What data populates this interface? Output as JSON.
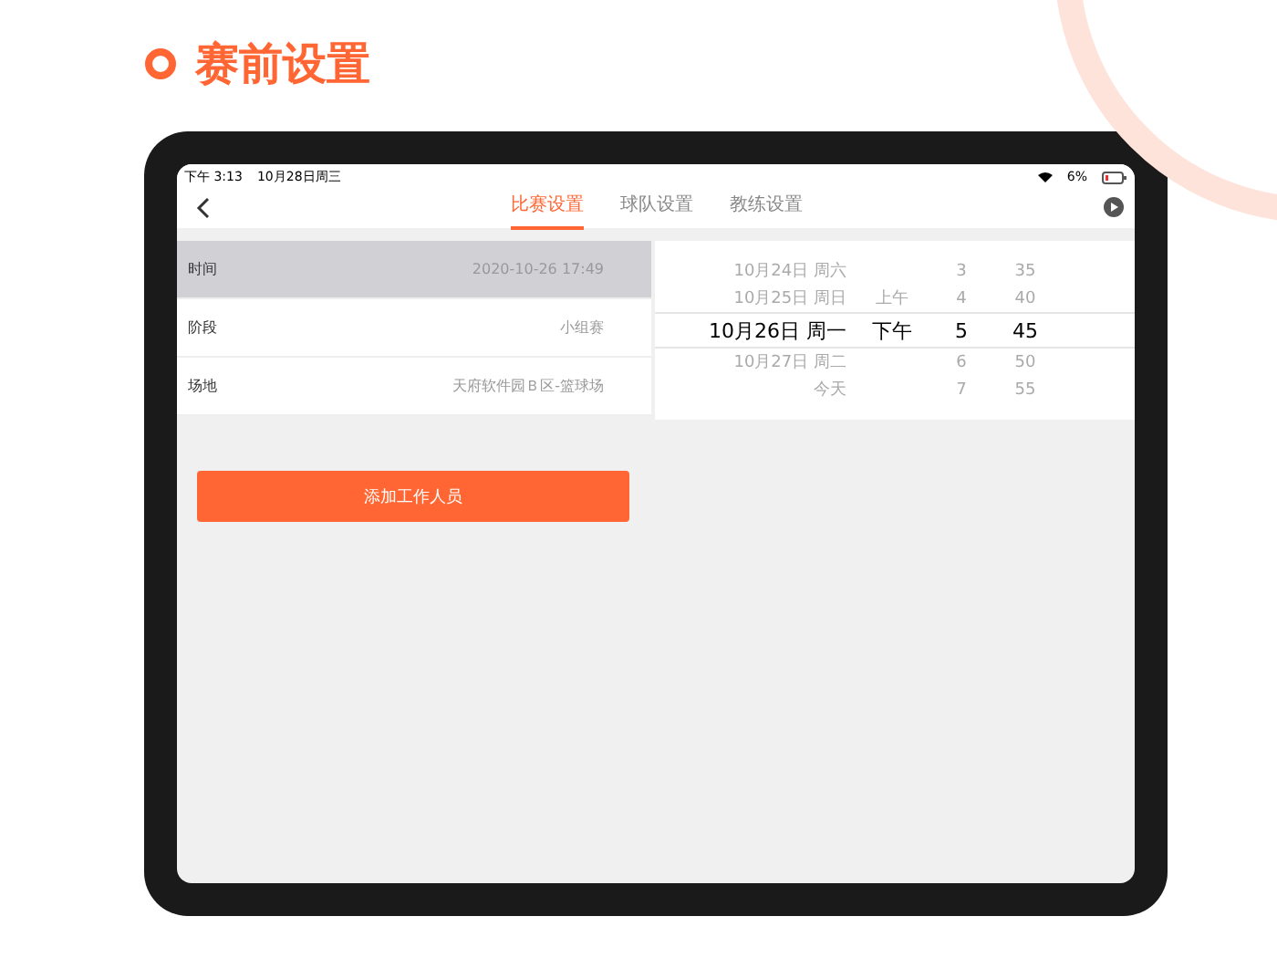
{
  "page_title": "赛前设置",
  "status_bar": {
    "time": "下午 3:13",
    "date": "10月28日周三",
    "battery": "6%"
  },
  "tabs": [
    {
      "label": "比赛设置",
      "selected": true
    },
    {
      "label": "球队设置",
      "selected": false
    },
    {
      "label": "教练设置",
      "selected": false
    }
  ],
  "fields": [
    {
      "label": "时间",
      "value": "2020-10-26 17:49",
      "selected": true
    },
    {
      "label": "阶段",
      "value": "小组赛",
      "selected": false
    },
    {
      "label": "场地",
      "value": "天府软件园Ｂ区-篮球场",
      "selected": false
    }
  ],
  "add_button": "添加工作人员",
  "picker_rows": [
    {
      "date": "10月24日 周六",
      "hour": "3",
      "minute": "35",
      "selected": false
    },
    {
      "date": "10月25日 周日",
      "period": "上午",
      "hour": "4",
      "minute": "40",
      "selected": false
    },
    {
      "date": "10月26日 周一",
      "period": "下午",
      "hour": "5",
      "minute": "45",
      "selected": true
    },
    {
      "date": "10月27日 周二",
      "hour": "6",
      "minute": "50",
      "selected": false
    },
    {
      "date": "今天",
      "hour": "7",
      "minute": "55",
      "selected": false
    }
  ]
}
